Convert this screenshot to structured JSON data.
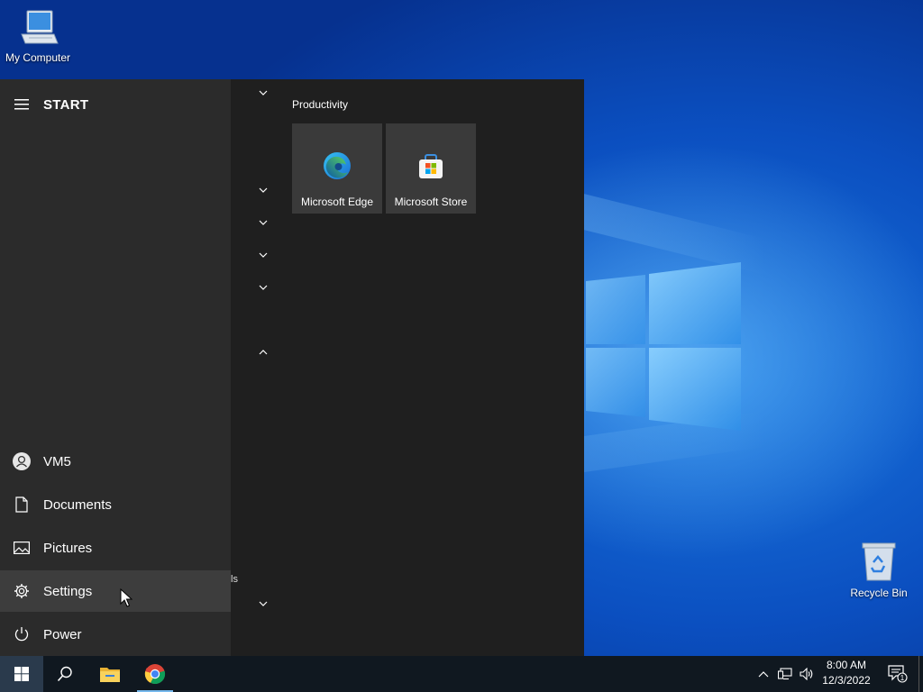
{
  "desktop": {
    "icons": [
      {
        "label": "My Computer",
        "icon": "computer-icon"
      },
      {
        "label": "Recycle Bin",
        "icon": "recycle-bin-icon"
      }
    ],
    "wallpaper_colors": {
      "deep": "#06318f",
      "mid": "#0b4fc0",
      "glow": "#78c8ff"
    }
  },
  "start_menu": {
    "title": "START",
    "side_items": [
      {
        "label": "VM5",
        "icon": "user-icon"
      },
      {
        "label": "Documents",
        "icon": "document-icon"
      },
      {
        "label": "Pictures",
        "icon": "pictures-icon"
      },
      {
        "label": "Settings",
        "icon": "gear-icon",
        "hovered": true
      },
      {
        "label": "Power",
        "icon": "power-icon"
      }
    ],
    "app_list_partial_text": "ls",
    "tile_group": {
      "title": "Productivity",
      "tiles": [
        {
          "label": "Microsoft Edge",
          "icon": "edge-icon"
        },
        {
          "label": "Microsoft Store",
          "icon": "store-icon"
        }
      ]
    },
    "colors": {
      "panel": "#1f1f1f",
      "sidebar": "#2b2b2b",
      "tile": "#3a3a3a",
      "hover": "#3d3d3d"
    }
  },
  "taskbar": {
    "pinned": [
      {
        "name": "start",
        "icon": "windows-logo-icon"
      },
      {
        "name": "search",
        "icon": "search-icon"
      },
      {
        "name": "file-explorer",
        "icon": "folder-icon"
      },
      {
        "name": "chrome",
        "icon": "chrome-icon",
        "active": true
      }
    ],
    "tray": [
      "chevron-up-icon",
      "network-icon",
      "volume-icon"
    ],
    "clock": {
      "time": "8:00 AM",
      "date": "12/3/2022"
    },
    "notifications": {
      "count": "1",
      "icon": "action-center-icon"
    },
    "color": "#101820"
  }
}
